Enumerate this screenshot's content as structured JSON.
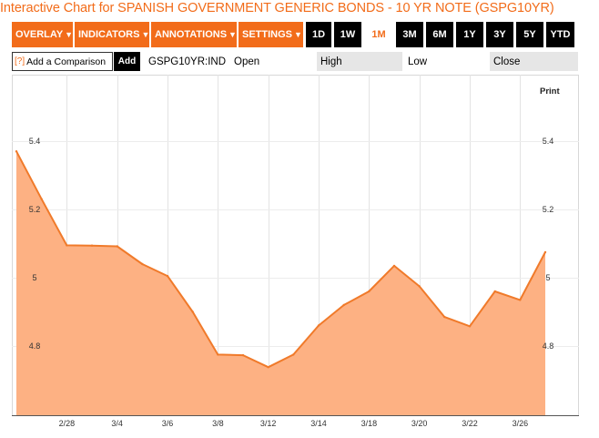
{
  "title": "Interactive Chart for SPANISH GOVERNMENT GENERIC BONDS - 10 YR NOTE (GSPG10YR)",
  "toolbar": {
    "menus": [
      {
        "label": "OVERLAY"
      },
      {
        "label": "INDICATORS"
      },
      {
        "label": "ANNOTATIONS"
      },
      {
        "label": "SETTINGS"
      }
    ],
    "ranges": [
      "1D",
      "1W",
      "1M",
      "3M",
      "6M",
      "1Y",
      "3Y",
      "5Y",
      "YTD"
    ],
    "active_range": "1M"
  },
  "comparison": {
    "placeholder_mark": "[?]",
    "label": "Add a Comparison",
    "add_label": "Add"
  },
  "quote": {
    "ticker": "GSPG10YR:IND",
    "open_label": "Open",
    "high_label": "High",
    "low_label": "Low",
    "close_label": "Close"
  },
  "print_label": "Print",
  "colors": {
    "accent": "#f26c1a",
    "fill": "#fdb183",
    "line": "#f07a2a"
  },
  "chart_data": {
    "type": "area",
    "title": "",
    "xlabel": "",
    "ylabel": "",
    "x": [
      "2/26",
      "2/27",
      "2/28",
      "3/1",
      "3/4",
      "3/5",
      "3/6",
      "3/7",
      "3/8",
      "3/11",
      "3/12",
      "3/13",
      "3/14",
      "3/15",
      "3/18",
      "3/19",
      "3/20",
      "3/21",
      "3/22",
      "3/25",
      "3/26",
      "3/27"
    ],
    "series": [
      {
        "values": [
          5.37,
          5.23,
          5.095,
          5.094,
          5.092,
          5.04,
          5.005,
          4.9,
          4.775,
          4.773,
          4.738,
          4.775,
          4.86,
          4.92,
          4.96,
          5.035,
          4.975,
          4.885,
          4.858,
          4.96,
          4.935,
          5.075
        ]
      }
    ],
    "xticks": [
      "2/28",
      "3/4",
      "3/6",
      "3/8",
      "3/12",
      "3/14",
      "3/18",
      "3/20",
      "3/22",
      "3/26"
    ],
    "xtick_indices": [
      2,
      4,
      6,
      8,
      10,
      12,
      14,
      16,
      18,
      20
    ],
    "yticks": [
      4.8,
      5,
      5.2,
      5.4
    ],
    "ytick_labels": [
      "4.8",
      "5",
      "5.2",
      "5.4"
    ],
    "ylim": [
      4.6,
      5.6
    ],
    "grid": true,
    "legend": "none"
  }
}
